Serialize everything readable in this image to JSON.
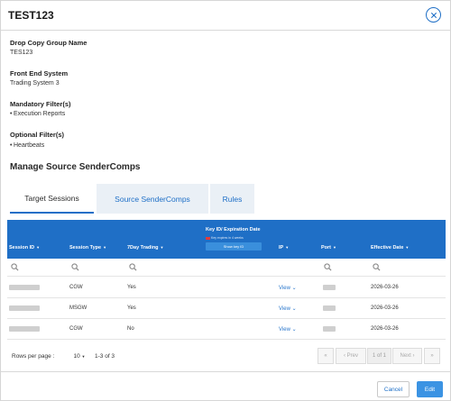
{
  "modal": {
    "title": "TEST123",
    "close_icon": "close-circle-icon"
  },
  "details": {
    "group_name_label": "Drop Copy Group Name",
    "group_name_value": "TES123",
    "front_end_label": "Front End System",
    "front_end_value": "Trading System 3",
    "mandatory_label": "Mandatory Filter(s)",
    "mandatory_items": [
      "Execution Reports"
    ],
    "optional_label": "Optional Filter(s)",
    "optional_items": [
      "Heartbeats"
    ]
  },
  "section_title": "Manage Source SenderComps",
  "tabs": [
    {
      "label": "Target Sessions",
      "active": true
    },
    {
      "label": "Source SenderComps",
      "active": false
    },
    {
      "label": "Rules",
      "active": false
    }
  ],
  "grid": {
    "columns": {
      "session_id": "Session ID",
      "session_type": "Session Type",
      "trading_7day": "7Day Trading",
      "key_id": "Key ID/ Expiration Date",
      "ip": "IP",
      "port": "Port",
      "effective_date": "Effective Date"
    },
    "key_warning": "Key expires in 4 weeks",
    "show_key_label": "Show key ID",
    "sort_icon": "sort-down-icon",
    "filter_icon": "search-icon",
    "rows": [
      {
        "session_type": "CGW",
        "trading_7day": "Yes",
        "ip": "View",
        "effective_date": "2026-03-26"
      },
      {
        "session_type": "MSGW",
        "trading_7day": "Yes",
        "ip": "View",
        "effective_date": "2026-03-26"
      },
      {
        "session_type": "CGW",
        "trading_7day": "No",
        "ip": "View",
        "effective_date": "2026-03-26"
      }
    ]
  },
  "pager": {
    "rows_per_page_label": "Rows per page :",
    "rows_per_page_value": "10",
    "range": "1-3 of 3",
    "first": "«",
    "prev": "‹ Prev",
    "current": "1 of 1",
    "next": "Next ›",
    "last": "»"
  },
  "footer": {
    "cancel_label": "Cancel",
    "edit_label": "Edit"
  },
  "colors": {
    "accent": "#1f6fc6",
    "header_bg": "#1f6fc6",
    "tab_inactive_bg": "#eaf0f6",
    "edit_button": "#3b93e3"
  }
}
